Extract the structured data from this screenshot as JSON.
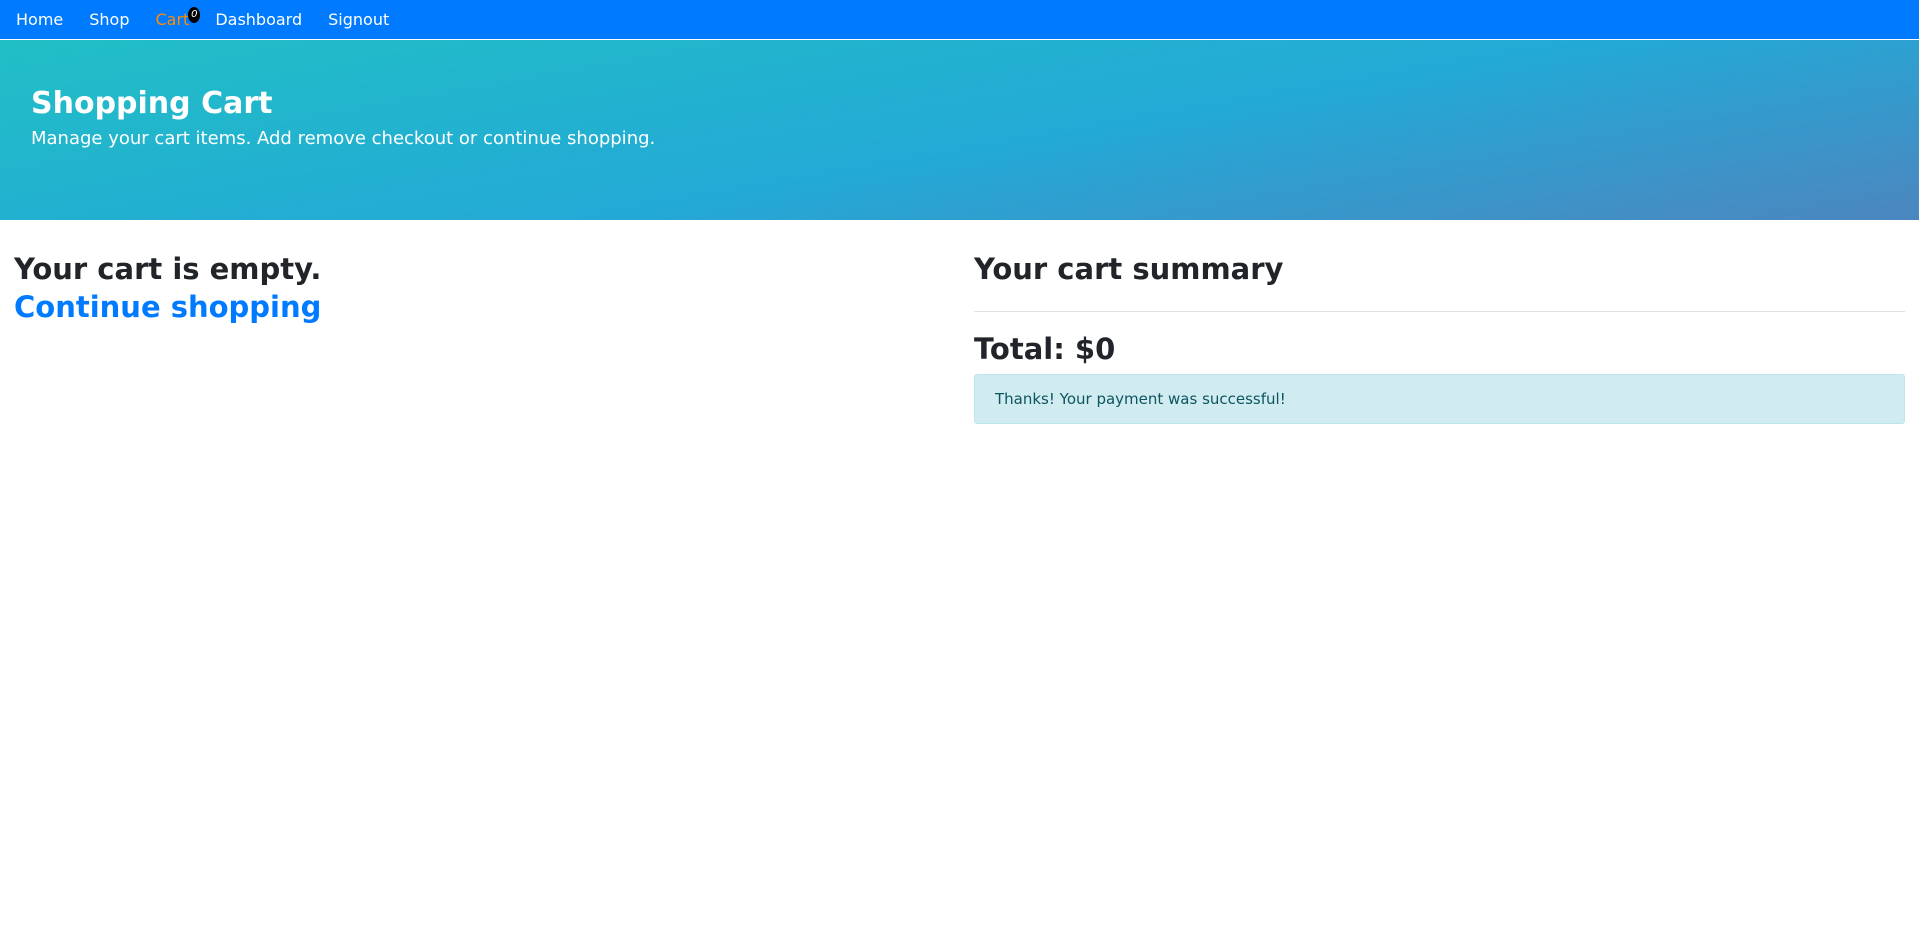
{
  "nav": {
    "items": [
      {
        "label": "Home"
      },
      {
        "label": "Shop"
      },
      {
        "label": "Cart",
        "badge": "0"
      },
      {
        "label": "Dashboard"
      },
      {
        "label": "Signout"
      }
    ]
  },
  "header": {
    "title": "Shopping Cart",
    "subtitle": "Manage your cart items. Add remove checkout or continue shopping."
  },
  "cart": {
    "empty_text": "Your cart is empty.",
    "continue_link": "Continue shopping"
  },
  "summary": {
    "title": "Your cart summary",
    "total": "Total: $0",
    "alert": "Thanks! Your payment was successful!"
  },
  "colors": {
    "navbar": "#007bff",
    "active_nav": "#ff8c00",
    "link": "#007bff",
    "alert_bg": "#d1ecf1"
  }
}
